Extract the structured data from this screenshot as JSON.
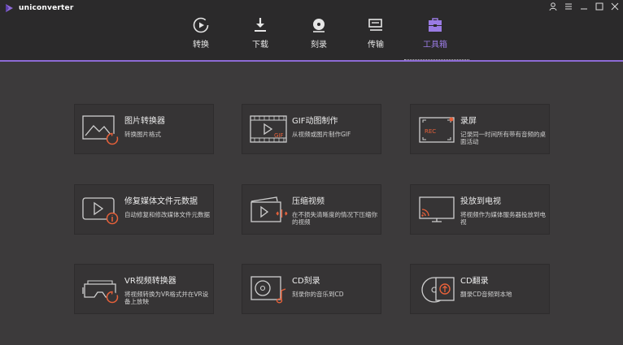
{
  "app": {
    "title": "uniconverter"
  },
  "window_controls": [
    "user-icon",
    "menu-icon",
    "minimize-icon",
    "maximize-icon",
    "close-icon"
  ],
  "nav": {
    "items": [
      {
        "label": "转换",
        "icon": "convert-icon"
      },
      {
        "label": "下载",
        "icon": "download-icon"
      },
      {
        "label": "刻录",
        "icon": "burn-icon"
      },
      {
        "label": "传输",
        "icon": "transfer-icon"
      },
      {
        "label": "工具箱",
        "icon": "toolbox-icon",
        "active": true
      }
    ]
  },
  "colors": {
    "accent": "#9a7be3",
    "icon_accent": "#e8613a",
    "background": "#3c3a3b",
    "topbar": "#2b2a2b"
  },
  "tools": [
    {
      "title": "图片转换器",
      "desc": "转换图片格式",
      "icon": "image-convert-icon"
    },
    {
      "title": "GIF动图制作",
      "desc": "从视频或图片制作GIF",
      "icon": "gif-maker-icon"
    },
    {
      "title": "录屏",
      "desc": "记录同一时间所有带有音频的桌面活动",
      "icon": "screen-record-icon"
    },
    {
      "title": "修复媒体文件元数据",
      "desc": "自动修复和修改媒体文件元数据",
      "icon": "fix-metadata-icon"
    },
    {
      "title": "压缩视频",
      "desc": "在不损失清晰度的情况下压缩你的视频",
      "icon": "compress-video-icon"
    },
    {
      "title": "投放到电视",
      "desc": "将视频作为媒体服务器投放到电视",
      "icon": "cast-tv-icon"
    },
    {
      "title": "VR视频转换器",
      "desc": "将视频转换为VR格式并在VR设备上放映",
      "icon": "vr-convert-icon"
    },
    {
      "title": "CD刻录",
      "desc": "刻录你的音乐到CD",
      "icon": "cd-burn-icon"
    },
    {
      "title": "CD翻录",
      "desc": "翻录CD音频到本地",
      "icon": "cd-rip-icon"
    }
  ]
}
